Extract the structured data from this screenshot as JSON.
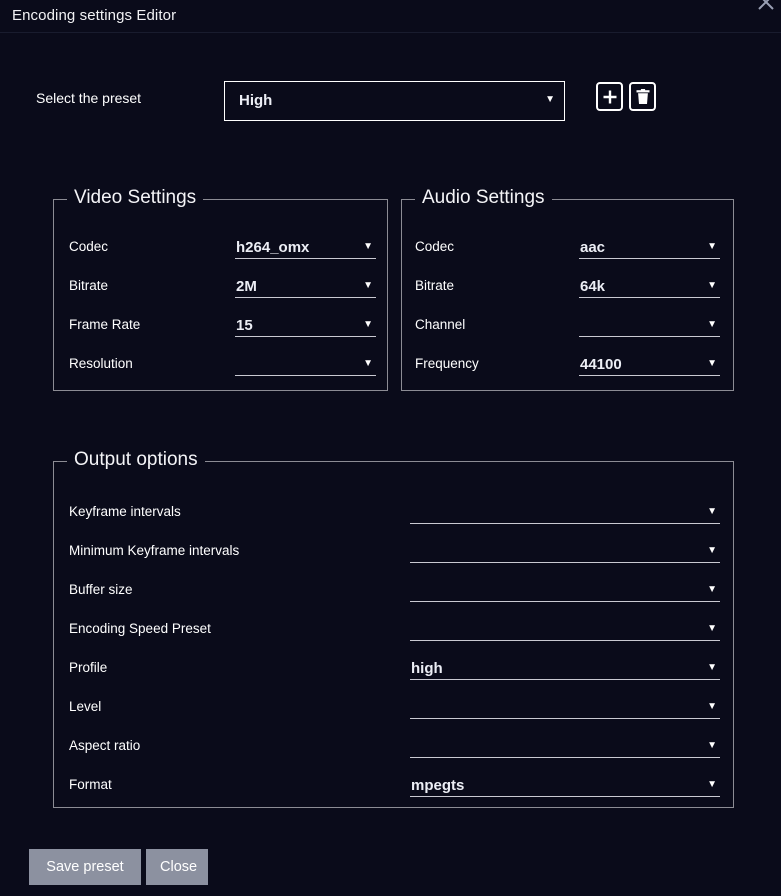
{
  "window": {
    "title": "Encoding settings Editor",
    "close_icon": "close-icon"
  },
  "preset": {
    "label": "Select the preset",
    "value": "High",
    "arrow": "▼",
    "add_button_icon": "plus-icon",
    "delete_button_icon": "trash-icon"
  },
  "video_settings": {
    "legend": "Video Settings",
    "fields": [
      {
        "label": "Codec",
        "value": "h264_omx",
        "arrow": "▼"
      },
      {
        "label": "Bitrate",
        "value": "2M",
        "arrow": "▼"
      },
      {
        "label": "Frame Rate",
        "value": "15",
        "arrow": "▼"
      },
      {
        "label": "Resolution",
        "value": "",
        "arrow": "▼"
      }
    ]
  },
  "audio_settings": {
    "legend": "Audio Settings",
    "fields": [
      {
        "label": "Codec",
        "value": "aac",
        "arrow": "▼"
      },
      {
        "label": "Bitrate",
        "value": "64k",
        "arrow": "▼"
      },
      {
        "label": "Channel",
        "value": "",
        "arrow": "▼"
      },
      {
        "label": "Frequency",
        "value": "44100",
        "arrow": "▼"
      }
    ]
  },
  "output_options": {
    "legend": "Output options",
    "fields": [
      {
        "label": "Keyframe intervals",
        "value": "",
        "arrow": "▼"
      },
      {
        "label": "Minimum Keyframe intervals",
        "value": "",
        "arrow": "▼"
      },
      {
        "label": "Buffer size",
        "value": "",
        "arrow": "▼"
      },
      {
        "label": "Encoding Speed Preset",
        "value": "",
        "arrow": "▼"
      },
      {
        "label": "Profile",
        "value": "high",
        "arrow": "▼"
      },
      {
        "label": "Level",
        "value": "",
        "arrow": "▼"
      },
      {
        "label": "Aspect ratio",
        "value": "",
        "arrow": "▼"
      },
      {
        "label": "Format",
        "value": "mpegts",
        "arrow": "▼"
      }
    ]
  },
  "footer": {
    "save_label": "Save preset",
    "close_label": "Close"
  },
  "colors": {
    "background": "#0a0b1a",
    "text": "#ffffff",
    "fieldset_border": "#8c8c94",
    "underline": "#c9c9d2",
    "button_background": "#8c91a0",
    "titlebar_divider": "#191c2e"
  }
}
